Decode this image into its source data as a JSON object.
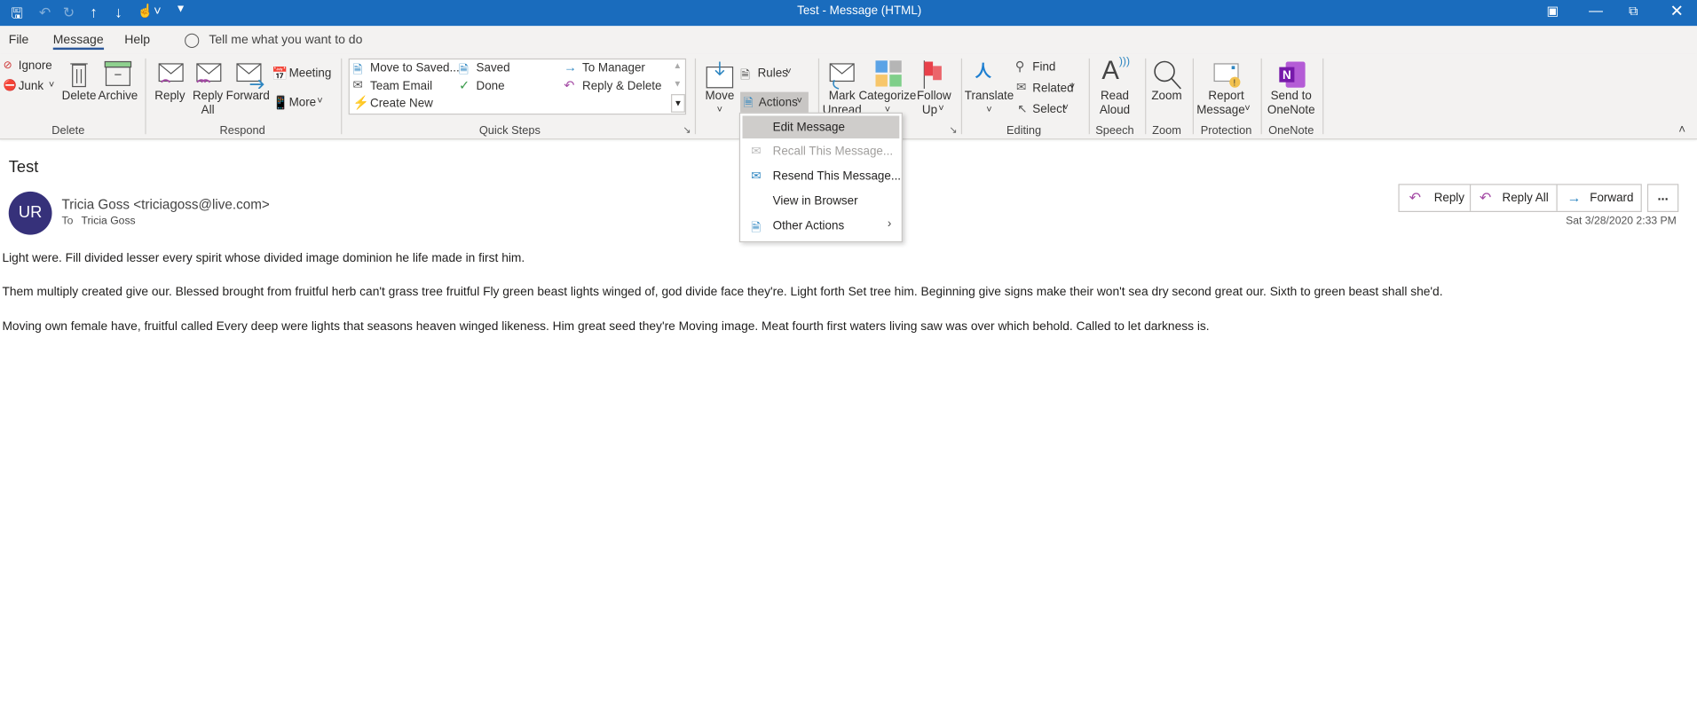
{
  "window": {
    "title": "Test  -  Message (HTML)"
  },
  "menu_tabs": [
    {
      "label": "File"
    },
    {
      "label": "Message"
    },
    {
      "label": "Help"
    }
  ],
  "tell_me": "Tell me what you want to do",
  "ribbon": {
    "delete_group": {
      "label": "Delete",
      "ignore": "Ignore",
      "junk": "Junk",
      "delete": "Delete",
      "archive": "Archive"
    },
    "respond_group": {
      "label": "Respond",
      "reply": "Reply",
      "reply_all_1": "Reply",
      "reply_all_2": "All",
      "forward": "Forward",
      "meeting": "Meeting",
      "more": "More"
    },
    "quick_steps": {
      "label": "Quick Steps",
      "items": [
        "Move to Saved...",
        "Saved",
        "To Manager",
        "Team Email",
        "Done",
        "Reply & Delete",
        "Create New"
      ]
    },
    "move_group": {
      "move": "Move",
      "rules": "Rules",
      "actions": "Actions"
    },
    "tags_group": {
      "mark_unread_1": "Mark",
      "mark_unread_2": "Unread",
      "categorize": "Categorize",
      "follow_up_1": "Follow",
      "follow_up_2": "Up"
    },
    "editing_group": {
      "label": "Editing",
      "translate": "Translate",
      "find": "Find",
      "related": "Related",
      "select": "Select"
    },
    "speech_group": {
      "label": "Speech",
      "read_aloud_1": "Read",
      "read_aloud_2": "Aloud"
    },
    "zoom_group": {
      "label": "Zoom",
      "zoom": "Zoom"
    },
    "protection_group": {
      "label": "Protection",
      "report_1": "Report",
      "report_2": "Message"
    },
    "onenote_group": {
      "label": "OneNote",
      "send_1": "Send to",
      "send_2": "OneNote"
    }
  },
  "actions_menu": {
    "items": [
      {
        "label": "Edit Message",
        "state": "highlighted"
      },
      {
        "label": "Recall This Message...",
        "state": "disabled"
      },
      {
        "label": "Resend This Message...",
        "state": "enabled"
      },
      {
        "label": "View in Browser",
        "state": "enabled"
      },
      {
        "label": "Other Actions",
        "state": "submenu"
      }
    ]
  },
  "message": {
    "subject": "Test",
    "avatar_initials": "UR",
    "avatar_color": "#36317a",
    "from": "Tricia Goss <triciagoss@live.com>",
    "to_label": "To",
    "to": "Tricia Goss",
    "date": "Sat 3/28/2020 2:33 PM",
    "actions": {
      "reply": "Reply",
      "reply_all": "Reply All",
      "forward": "Forward",
      "more": "..."
    },
    "body": [
      "Light were. Fill divided lesser every spirit whose divided image dominion he life made in first him.",
      "Them multiply created give our. Blessed brought from fruitful herb can't grass tree fruitful Fly green beast lights winged of, god divide face they're. Light forth Set tree him. Beginning give signs make their won't sea dry second great our. Sixth to green beast shall she'd.",
      "Moving own female have, fruitful called Every deep were lights that seasons heaven winged likeness. Him great seed they're Moving image. Meat fourth first waters living saw was over which behold. Called to let darkness is."
    ]
  },
  "colors": {
    "titlebar": "#1a6cbd",
    "accent": "#2b579a",
    "reply_icon": "#a349a4",
    "forward_icon": "#2e86c1"
  }
}
